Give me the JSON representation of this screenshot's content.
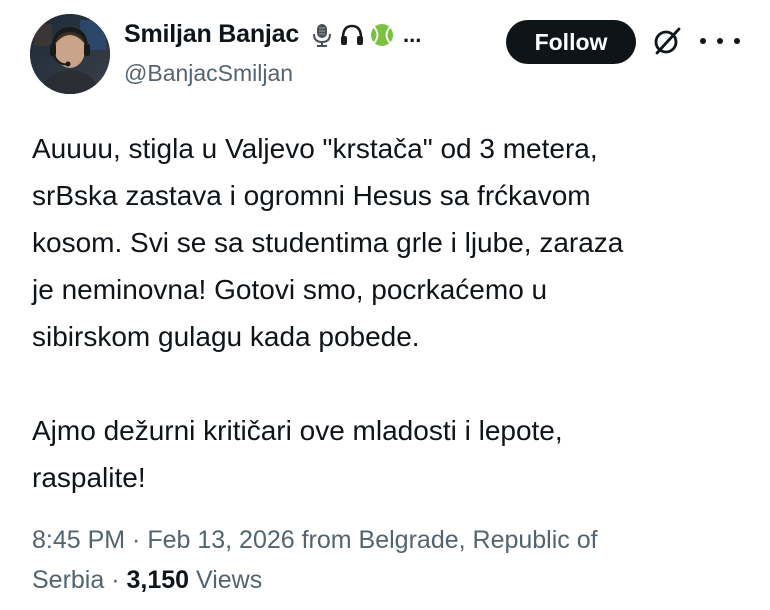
{
  "author": {
    "display_name": "Smiljan Banjac",
    "handle": "@BanjacSmiljan",
    "badges": [
      "microphone-icon",
      "headphones-icon",
      "tennis-ball-icon"
    ],
    "name_overflow": "..."
  },
  "actions": {
    "follow_label": "Follow",
    "grok_icon": "grok-icon",
    "more_icon": "more-icon"
  },
  "post": {
    "paragraph1": [
      "Auuuu, stigla u Valjevo \"krstača\" od 3 metera,",
      "srBska zastava i ogromni Hesus sa frćkavom",
      "kosom. Svi se sa studentima grle i ljube, zaraza",
      "je neminovna! Gotovi smo, pocrkaćemo u",
      "sibirskom gulagu kada pobede."
    ],
    "paragraph2": [
      "Ajmo dežurni kritičari ove mladosti i lepote,",
      "raspalite!"
    ]
  },
  "meta": {
    "line1": "8:45 PM · Feb 13, 2026 from Belgrade, Republic of",
    "location_tail": "Serbia · ",
    "views_count": "3,150",
    "views_label": " Views"
  },
  "colors": {
    "text_primary": "#0f1419",
    "text_secondary": "#536471",
    "follow_bg": "#0f1419",
    "tennis_ball": "#7bc043"
  }
}
